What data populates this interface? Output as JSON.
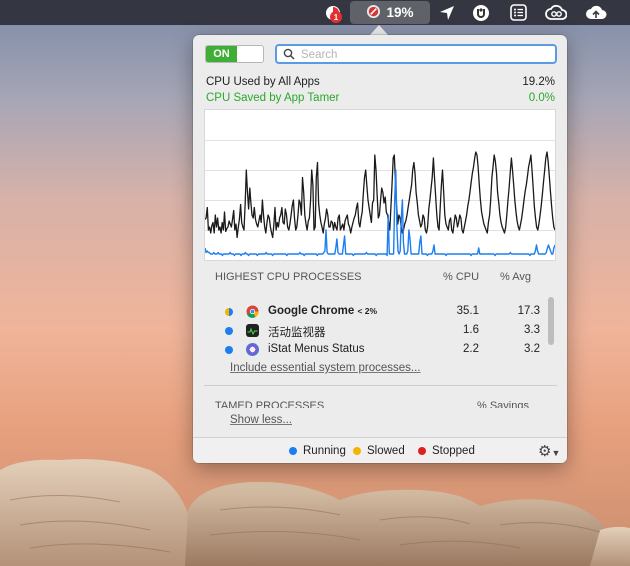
{
  "menubar": {
    "notification_badge": "1",
    "app_tamer_cpu": "19%",
    "icons": [
      "notification-icon",
      "app-tamer-icon",
      "location-arrow-icon",
      "shield-monitor-icon",
      "list-icon",
      "creative-cloud-icon",
      "cloud-upload-icon"
    ]
  },
  "app_tamer": {
    "toggle_label": "ON",
    "search_placeholder": "Search",
    "cpu_used_label": "CPU Used by All Apps",
    "cpu_used_value": "19.2%",
    "cpu_saved_label": "CPU Saved by App Tamer",
    "cpu_saved_value": "0.0%",
    "processes_header": {
      "title": "HIGHEST CPU PROCESSES",
      "cpu": "% CPU",
      "avg": "% Avg"
    },
    "processes": [
      {
        "name": "Google Chrome",
        "suffix": "< 2%",
        "cpu": "35.1",
        "avg": "17.3",
        "status": "running",
        "icon": "chrome-icon",
        "bold": true
      },
      {
        "name": "活动监视器",
        "suffix": "",
        "cpu": "1.6",
        "avg": "3.3",
        "status": "running",
        "icon": "activity-monitor-icon",
        "bold": false
      },
      {
        "name": "iStat Menus Status",
        "suffix": "",
        "cpu": "2.2",
        "avg": "3.2",
        "status": "running",
        "icon": "istat-menus-icon",
        "bold": false
      }
    ],
    "include_system_link": "Include essential system processes...",
    "tamed_header": {
      "title": "TAMED PROCESSES",
      "savings": "% Savings"
    },
    "show_less_link": "Show less...",
    "legend": {
      "running": "Running",
      "slowed": "Slowed",
      "stopped": "Stopped"
    },
    "colors": {
      "running": "#1c7ef0",
      "slowed": "#f5b400",
      "stopped": "#e0201f",
      "on_green": "#3fae36",
      "saved_green": "#2aa82a"
    }
  },
  "chart_data": {
    "type": "line",
    "title": "",
    "ylim": [
      0,
      100
    ],
    "grid": true,
    "series": [
      {
        "values": [
          27,
          28,
          35,
          20,
          22,
          18,
          23,
          25,
          18,
          30,
          22,
          28,
          20,
          22,
          18,
          25,
          20,
          32,
          19,
          21,
          22,
          26,
          24,
          22,
          27,
          33,
          20,
          24,
          15,
          22,
          27,
          37,
          25,
          22,
          20,
          38,
          60,
          45,
          34,
          48,
          38,
          30,
          28,
          35,
          27,
          24,
          22,
          26,
          30,
          25,
          40,
          30,
          22,
          18,
          25,
          30,
          28,
          22,
          18,
          15,
          24,
          35,
          20,
          25,
          22,
          28,
          30,
          35,
          25,
          24,
          34,
          30,
          22,
          20,
          24,
          30,
          36,
          40,
          28,
          20,
          22,
          30,
          40,
          38,
          30,
          55,
          45,
          30,
          24,
          20,
          26,
          28,
          40,
          60,
          50,
          20,
          22,
          55,
          65,
          38,
          30,
          25,
          22,
          18,
          24,
          28,
          34,
          30,
          22,
          22,
          26,
          25,
          20,
          25,
          22,
          20,
          28,
          30,
          20,
          22,
          24,
          20,
          26,
          28,
          30,
          24,
          22,
          18,
          22,
          25,
          28,
          30,
          35,
          38,
          25,
          22,
          28,
          32,
          45,
          55,
          60,
          50,
          40,
          35,
          30,
          25,
          38,
          40,
          70,
          60,
          44,
          28,
          30,
          40,
          48,
          45,
          38,
          42,
          32,
          30,
          25,
          20,
          35,
          50,
          68,
          70,
          52,
          36,
          24,
          30,
          28,
          22,
          18,
          20,
          24,
          26,
          30,
          35,
          40,
          45,
          50,
          60,
          65,
          58,
          45,
          38,
          30,
          26,
          22,
          24,
          30,
          28,
          20,
          18,
          22,
          34,
          40,
          48,
          55,
          68,
          55,
          42,
          30,
          22,
          20,
          35,
          50,
          60,
          45,
          30,
          24,
          22,
          20,
          26,
          28,
          20,
          18,
          24,
          30,
          28,
          22,
          25,
          30,
          28,
          20,
          18,
          22,
          26,
          30,
          36,
          40,
          46,
          52,
          58,
          62,
          68,
          72,
          70,
          62,
          50,
          40,
          32,
          28,
          24,
          22,
          20,
          18,
          25,
          30,
          40,
          55,
          62,
          70,
          66,
          58,
          45,
          38,
          30,
          25,
          22,
          20,
          18,
          22,
          30,
          40,
          48,
          58,
          68,
          60,
          50,
          40,
          32,
          26,
          22,
          20,
          24,
          28,
          34,
          40,
          46,
          50,
          56,
          62,
          66,
          70,
          60,
          48,
          36,
          28,
          22,
          20,
          24,
          30,
          36,
          44,
          52,
          60,
          68,
          72,
          66,
          56,
          46,
          36,
          28,
          22,
          20
        ]
      },
      {
        "values": [
          8,
          5,
          6,
          5,
          5,
          4,
          4,
          4,
          5,
          4,
          4,
          4,
          5,
          4,
          4,
          4,
          3,
          4,
          4,
          4,
          4,
          4,
          4,
          5,
          4,
          4,
          4,
          3,
          4,
          4,
          4,
          4,
          4,
          3,
          4,
          4,
          4,
          5,
          4,
          4,
          3,
          4,
          4,
          4,
          4,
          4,
          4,
          4,
          3,
          4,
          4,
          4,
          4,
          4,
          4,
          4,
          5,
          4,
          4,
          4,
          4,
          4,
          3,
          4,
          4,
          4,
          4,
          4,
          4,
          4,
          4,
          4,
          4,
          4,
          4,
          3,
          4,
          4,
          4,
          4,
          4,
          4,
          4,
          4,
          4,
          4,
          4,
          5,
          4,
          4,
          4,
          3,
          4,
          4,
          4,
          4,
          4,
          4,
          4,
          4,
          4,
          4,
          4,
          3,
          4,
          4,
          4,
          4,
          4,
          5,
          6,
          20,
          5,
          4,
          4,
          4,
          4,
          4,
          4,
          4,
          8,
          14,
          5,
          4,
          4,
          4,
          4,
          10,
          16,
          4,
          4,
          4,
          4,
          4,
          4,
          4,
          3,
          4,
          4,
          4,
          4,
          4,
          4,
          4,
          4,
          4,
          4,
          4,
          5,
          4,
          4,
          4,
          4,
          4,
          4,
          4,
          4,
          3,
          4,
          4,
          4,
          4,
          4,
          4,
          4,
          4,
          4,
          3,
          30,
          4,
          4,
          4,
          4,
          4,
          40,
          60,
          22,
          6,
          4,
          6,
          28,
          40,
          12,
          4,
          4,
          4,
          6,
          20,
          14,
          4,
          4,
          4,
          4,
          4,
          4,
          4,
          4,
          12,
          16,
          4,
          4,
          4,
          4,
          4,
          3,
          4,
          4,
          4,
          4,
          6,
          10,
          4,
          4,
          4,
          4,
          4,
          4,
          4,
          4,
          4,
          4,
          3,
          4,
          4,
          4,
          4,
          4,
          4,
          4,
          4,
          4,
          4,
          4,
          4,
          4,
          4,
          4,
          4,
          4,
          4,
          4,
          4,
          4,
          4,
          3,
          4,
          4,
          4,
          4,
          4,
          4,
          8,
          4,
          4,
          4,
          4,
          4,
          4,
          4,
          4,
          4,
          4,
          4,
          4,
          4,
          4,
          3,
          4,
          4,
          4,
          4,
          4,
          4,
          4,
          4,
          4,
          4,
          4,
          4,
          4,
          5,
          4,
          4,
          4,
          4,
          4,
          4,
          4,
          4,
          4,
          4,
          4,
          4,
          4,
          4,
          4,
          4,
          4,
          3,
          4,
          4,
          4,
          4,
          6,
          10,
          6,
          4,
          4,
          4,
          4,
          4,
          4,
          4,
          5,
          8,
          10,
          8,
          6,
          4,
          4,
          8,
          10
        ]
      }
    ]
  }
}
